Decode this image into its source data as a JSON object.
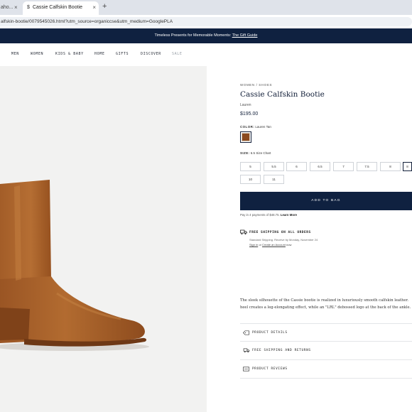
{
  "browser": {
    "inactive_tab_title": "aho...",
    "active_tab_title": "Cassie Calfskin Bootie",
    "url": "alfskin-bootie/0079545026.html?utm_source=organiccse&utm_medium=GooglePLA"
  },
  "promo": {
    "text": "Timeless Presents for Memorable Moments:",
    "link": "The Gift Guide"
  },
  "nav": {
    "items": [
      "MEN",
      "WOMEN",
      "KIDS & BABY",
      "HOME",
      "GIFTS",
      "DISCOVER",
      "SALE"
    ]
  },
  "product": {
    "breadcrumb": "WOMEN / SHOES",
    "title": "Cassie Calfskin Bootie",
    "brand": "Lauren",
    "price": "$195.00",
    "color_label": "COLOR:",
    "color_value": "Lauren Tan",
    "swatch_color": "#8b4a1f",
    "size_label": "SIZE:",
    "size_value": "6.5",
    "size_chart": "Size Chart",
    "sizes": [
      "5",
      "5.5",
      "6",
      "6.5",
      "7",
      "7.5",
      "8",
      "8",
      "10",
      "11"
    ],
    "selected_size_index": 7,
    "add_to_bag": "ADD TO BAG",
    "installments_text": "Pay in 4 payments of $48.75.",
    "installments_link": "Learn More",
    "shipping_title": "FREE SHIPPING ON ALL ORDERS",
    "shipping_sub": "Standard Shipping. Receive by Monday, November 24",
    "shipping_link_prefix": "Sign in",
    "shipping_link_mid": " or ",
    "shipping_link_create": "Create an Account",
    "shipping_link_suffix": " now",
    "description_line1": "The sleek silhouette of the Cassie bootie is realized in luxuriously smooth calfskin leather.",
    "description_line2": "heel creates a leg-elongating effect, while an \"LRL\" debossed logo at the back of the ankle."
  },
  "accordion": [
    {
      "label": "PRODUCT DETAILS",
      "icon": "tag-icon"
    },
    {
      "label": "FREE SHIPPING AND RETURNS",
      "icon": "truck-icon"
    },
    {
      "label": "PRODUCT REVIEWS",
      "icon": "review-icon"
    }
  ],
  "colors": {
    "navy": "#0f2140",
    "boot": "#a9622b",
    "image_bg": "#f2f2f1"
  }
}
